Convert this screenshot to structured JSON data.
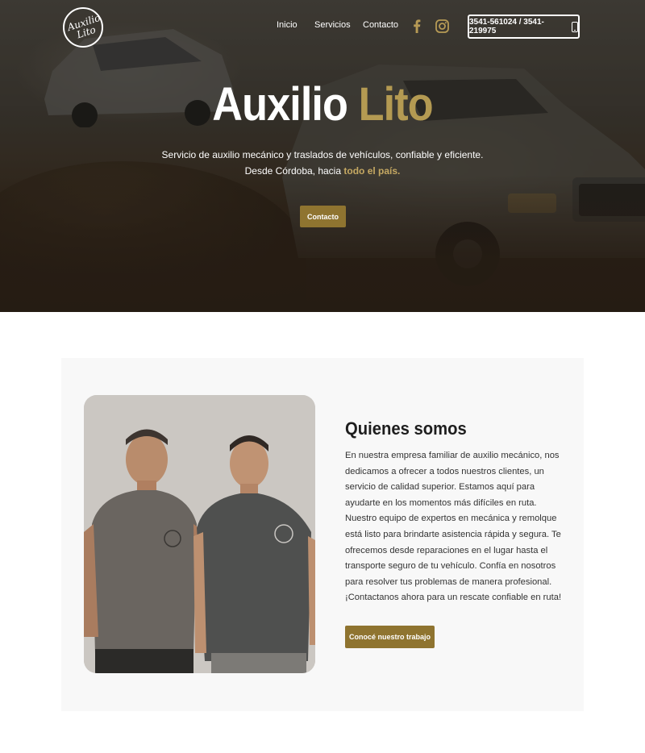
{
  "brand": {
    "logo_line1": "Auxilio",
    "logo_line2": "Lito"
  },
  "nav": {
    "items": [
      "Inicio",
      "Servicios",
      "Contacto"
    ]
  },
  "social": {
    "facebook_icon": "facebook-icon",
    "instagram_icon": "instagram-icon"
  },
  "phone": {
    "text": "3541-561024  /  3541-219975",
    "icon": "phone-icon"
  },
  "hero": {
    "title_white": "Auxilio",
    "title_accent": "Lito",
    "subtitle_line1": "Servicio de auxilio mecánico y traslados de vehículos, confiable y eficiente.",
    "subtitle_line2_prefix": "Desde Córdoba, hacia",
    "subtitle_line2_accent": "todo el país.",
    "cta": "Contacto"
  },
  "about": {
    "title": "Quienes somos",
    "text": "En nuestra empresa familiar de auxilio mecánico, nos dedicamos a ofrecer a todos nuestros clientes, un servicio de calidad superior. Estamos aquí para ayudarte en los momentos más difíciles en ruta. Nuestro equipo de expertos en mecánica y remolque está listo para brindarte asistencia rápida y segura. Te ofrecemos desde reparaciones en el lugar hasta el transporte seguro de tu vehículo. Confía en nosotros para resolver tus problemas de manera profesional.",
    "text2": "¡Contactanos ahora para un rescate confiable en ruta!",
    "cta": "Conocé nuestro trabajo"
  },
  "colors": {
    "accent": "#b49a52",
    "button": "#8f7430"
  }
}
